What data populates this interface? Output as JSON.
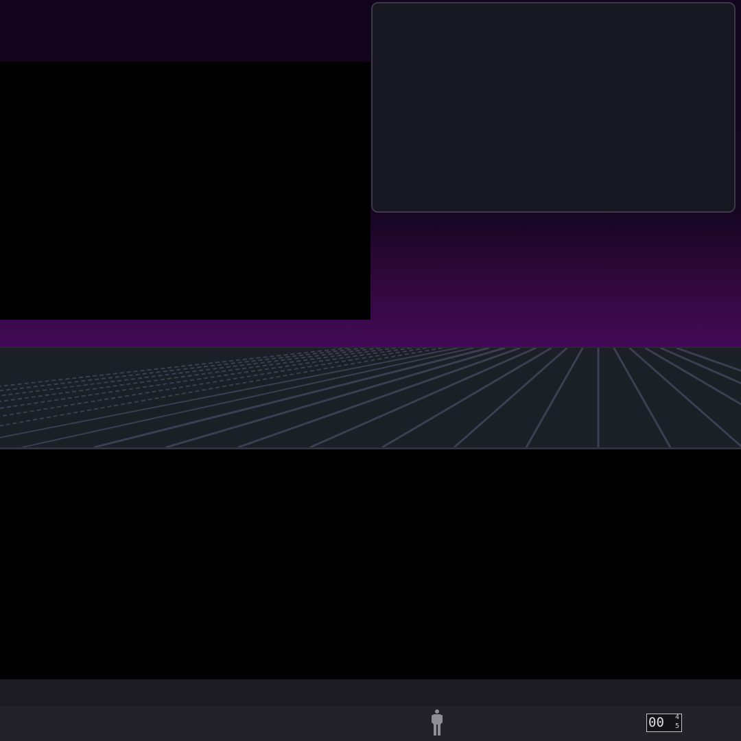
{
  "toolbar": {
    "person_icon": "standing-person-icon",
    "counter": {
      "main": "00",
      "superscript": "4",
      "subscript": "5"
    }
  },
  "colors": {
    "sky_top": "#12041c",
    "sky_bottom": "#430a58",
    "panel_bg": "#171722",
    "panel_border": "#3b3a46",
    "floor_bg": "#1b1f26",
    "grid_line": "#3a3f52",
    "toolbar_bg": "#232229"
  }
}
